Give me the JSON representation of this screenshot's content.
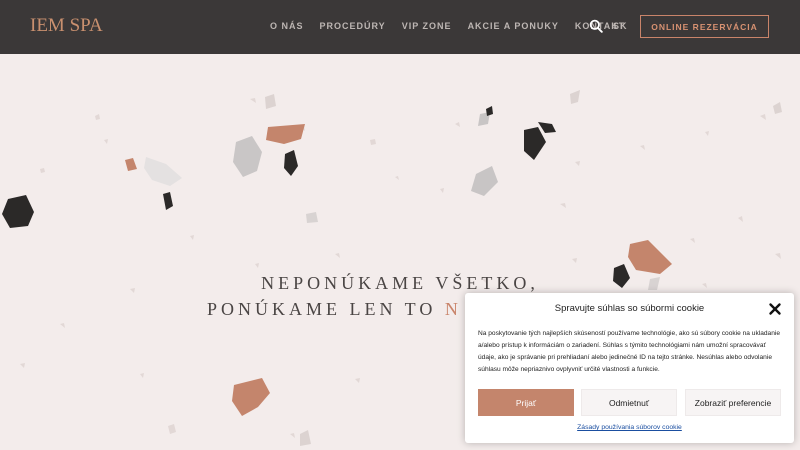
{
  "header": {
    "logo": "IEM SPA",
    "nav": [
      "O NÁS",
      "PROCEDÚRY",
      "VIP ZONE",
      "AKCIE A PONUKY",
      "KONTAKT"
    ],
    "language": "SK",
    "cta_label": "ONLINE REZERVÁCIA",
    "icons": {
      "search": "search-icon"
    }
  },
  "hero": {
    "line1": "NEPONÚKAME VŠETKO,",
    "line2": "PONÚKAME LEN TO",
    "line2_accent": "N"
  },
  "cookie": {
    "title": "Spravujte súhlas so súbormi cookie",
    "text": "Na poskytovanie tých najlepších skúseností používame technológie, ako sú súbory cookie na ukladanie a/alebo prístup k informáciám o zariadení. Súhlas s týmito technológiami nám umožní spracovávať údaje, ako je správanie pri prehliadaní alebo jedinečné ID na tejto stránke. Nesúhlas alebo odvolanie súhlasu môže nepriaznivo ovplyvniť určité vlastnosti a funkcie.",
    "accept": "Prijať",
    "deny": "Odmietnuť",
    "preferences": "Zobraziť preferencie",
    "policy_link": "Zásady používania súborov cookie",
    "icons": {
      "close": "close-icon"
    }
  },
  "colors": {
    "header_bg": "#3b3838",
    "accent": "#c4856c",
    "page_bg": "#f3eceb"
  }
}
